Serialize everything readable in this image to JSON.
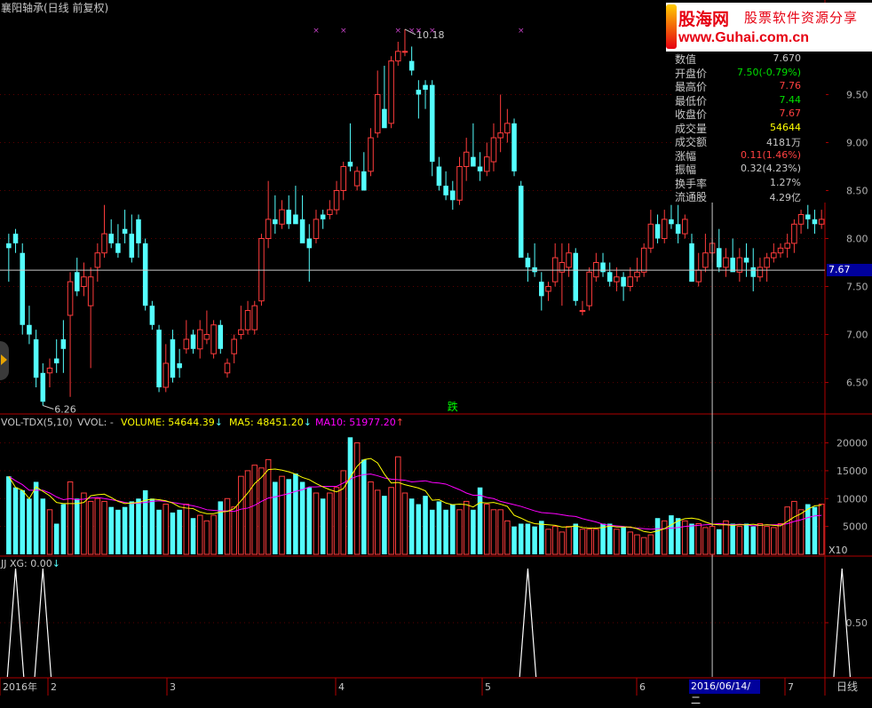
{
  "window": {
    "title": "襄阳轴承(日线 前复权)"
  },
  "ad": {
    "brand": "股海网",
    "slogan": "股票软件资源分享",
    "url": "www.Guhai.com.cn"
  },
  "main_chart": {
    "high_annotation": "10.18",
    "low_annotation": "6.26",
    "signal_text": "跌",
    "current_price": "7.67",
    "y_ticks": [
      "9.50",
      "9.00",
      "8.50",
      "8.00",
      "7.50",
      "7.00",
      "6.50"
    ],
    "info": [
      {
        "label": "数值",
        "value": "7.670",
        "color": "#c8c8c8"
      },
      {
        "label": "开盘价",
        "value": "7.50(-0.79%)",
        "color": "#00e000"
      },
      {
        "label": "最高价",
        "value": "7.76",
        "color": "#ff4040"
      },
      {
        "label": "最低价",
        "value": "7.44",
        "color": "#00e000"
      },
      {
        "label": "收盘价",
        "value": "7.67",
        "color": "#ff4040"
      },
      {
        "label": "成交量",
        "value": "54644",
        "color": "#ffff00"
      },
      {
        "label": "成交额",
        "value": "4181万",
        "color": "#c8c8c8"
      },
      {
        "label": "涨幅",
        "value": "0.11(1.46%)",
        "color": "#ff4040"
      },
      {
        "label": "振幅",
        "value": "0.32(4.23%)",
        "color": "#c8c8c8"
      },
      {
        "label": "换手率",
        "value": "1.27%",
        "color": "#c8c8c8"
      },
      {
        "label": "流通股",
        "value": "4.29亿",
        "color": "#c8c8c8"
      }
    ]
  },
  "volume_panel": {
    "name": "VOL-TDX(5,10)",
    "vvol": "VVOL: -",
    "volume": "VOLUME: 54644.39",
    "ma5": "MA5: 48451.20",
    "ma10": "MA10: 51977.20",
    "y_ticks": [
      "20000",
      "15000",
      "10000",
      "5000"
    ],
    "unit": "X10"
  },
  "jj_panel": {
    "title": "JJ XG: 0.00",
    "y_tick": "0.50"
  },
  "x_axis": {
    "labels": [
      "2016年",
      "2",
      "3",
      "4",
      "5",
      "6",
      "7"
    ],
    "cursor_date": "2016/06/14/二",
    "period": "日线"
  },
  "colors": {
    "up": "#ff3c3c",
    "down": "#54ffff",
    "ma5": "#ffff00",
    "ma10": "#ff00ff",
    "axis": "#b00000"
  },
  "chart_data": {
    "type": "candlestick",
    "title": "襄阳轴承(日线 前复权)",
    "price_ylim": [
      6.2,
      10.3
    ],
    "candles": [
      [
        7.95,
        8.05,
        7.55,
        7.9
      ],
      [
        8.05,
        8.1,
        7.85,
        7.95
      ],
      [
        7.85,
        7.95,
        7.0,
        7.1
      ],
      [
        7.1,
        7.3,
        6.9,
        7.0
      ],
      [
        6.95,
        7.05,
        6.45,
        6.55
      ],
      [
        6.6,
        6.7,
        6.26,
        6.3
      ],
      [
        6.6,
        6.75,
        6.45,
        6.65
      ],
      [
        6.75,
        6.95,
        6.6,
        6.7
      ],
      [
        6.95,
        7.15,
        6.6,
        6.85
      ],
      [
        7.2,
        7.65,
        6.35,
        7.55
      ],
      [
        7.65,
        7.8,
        7.4,
        7.45
      ],
      [
        7.5,
        7.75,
        7.4,
        7.6
      ],
      [
        7.3,
        7.7,
        6.65,
        7.6
      ],
      [
        7.7,
        7.95,
        7.55,
        7.85
      ],
      [
        7.85,
        8.35,
        7.8,
        8.05
      ],
      [
        8.05,
        8.2,
        7.9,
        7.95
      ],
      [
        7.95,
        8.15,
        7.8,
        7.85
      ],
      [
        8.1,
        8.3,
        7.95,
        8.05
      ],
      [
        8.05,
        8.25,
        7.75,
        7.8
      ],
      [
        8.2,
        8.25,
        7.8,
        7.95
      ],
      [
        7.95,
        8.0,
        7.25,
        7.3
      ],
      [
        7.3,
        7.35,
        7.05,
        7.1
      ],
      [
        7.05,
        7.1,
        6.4,
        6.45
      ],
      [
        6.45,
        6.9,
        6.4,
        6.7
      ],
      [
        6.95,
        7.05,
        6.5,
        6.55
      ],
      [
        6.7,
        6.85,
        6.55,
        6.65
      ],
      [
        6.85,
        7.15,
        6.8,
        6.95
      ],
      [
        7.0,
        7.05,
        6.8,
        6.85
      ],
      [
        6.85,
        7.15,
        6.75,
        7.05
      ],
      [
        6.95,
        7.25,
        6.9,
        7.0
      ],
      [
        6.8,
        7.15,
        6.75,
        7.1
      ],
      [
        7.1,
        7.15,
        6.8,
        6.85
      ],
      [
        6.6,
        6.75,
        6.55,
        6.7
      ],
      [
        6.8,
        7.0,
        6.7,
        6.95
      ],
      [
        7.0,
        7.3,
        6.95,
        7.05
      ],
      [
        7.05,
        7.35,
        7.0,
        7.25
      ],
      [
        7.05,
        7.35,
        7.0,
        7.3
      ],
      [
        7.35,
        8.05,
        7.3,
        8.0
      ],
      [
        8.0,
        8.6,
        7.9,
        8.2
      ],
      [
        8.2,
        8.45,
        8.05,
        8.15
      ],
      [
        8.15,
        8.4,
        8.1,
        8.3
      ],
      [
        8.3,
        8.45,
        8.1,
        8.15
      ],
      [
        8.25,
        8.55,
        8.2,
        8.15
      ],
      [
        8.2,
        8.45,
        8.05,
        7.95
      ],
      [
        8.0,
        8.15,
        7.55,
        7.9
      ],
      [
        8.0,
        8.3,
        7.95,
        8.2
      ],
      [
        8.25,
        8.3,
        8.1,
        8.2
      ],
      [
        8.25,
        8.4,
        8.2,
        8.3
      ],
      [
        8.3,
        8.6,
        8.25,
        8.5
      ],
      [
        8.5,
        8.8,
        8.4,
        8.75
      ],
      [
        8.8,
        9.2,
        8.7,
        8.75
      ],
      [
        8.55,
        8.75,
        8.5,
        8.7
      ],
      [
        8.7,
        8.9,
        8.55,
        8.5
      ],
      [
        8.7,
        9.15,
        8.65,
        9.05
      ],
      [
        9.1,
        9.75,
        9.05,
        9.5
      ],
      [
        9.35,
        9.8,
        9.2,
        9.15
      ],
      [
        9.2,
        9.9,
        9.15,
        9.85
      ],
      [
        9.85,
        10.05,
        9.8,
        9.95
      ],
      [
        9.95,
        10.18,
        9.9,
        9.95
      ],
      [
        9.85,
        10.0,
        9.7,
        9.75
      ],
      [
        9.55,
        9.65,
        9.25,
        9.5
      ],
      [
        9.6,
        9.65,
        9.35,
        9.55
      ],
      [
        9.6,
        9.65,
        8.65,
        8.8
      ],
      [
        8.75,
        8.85,
        8.5,
        8.55
      ],
      [
        8.55,
        8.7,
        8.4,
        8.45
      ],
      [
        8.5,
        8.6,
        8.3,
        8.4
      ],
      [
        8.4,
        8.85,
        8.35,
        8.75
      ],
      [
        8.75,
        9.05,
        8.6,
        8.9
      ],
      [
        8.85,
        9.2,
        8.8,
        8.75
      ],
      [
        8.75,
        8.9,
        8.6,
        8.7
      ],
      [
        8.7,
        9.0,
        8.65,
        8.85
      ],
      [
        8.8,
        9.2,
        8.7,
        9.05
      ],
      [
        9.05,
        9.5,
        8.9,
        9.1
      ],
      [
        9.1,
        9.35,
        9.0,
        9.2
      ],
      [
        9.2,
        9.25,
        8.65,
        8.7
      ],
      [
        8.55,
        8.6,
        7.85,
        7.8
      ],
      [
        7.8,
        7.85,
        7.55,
        7.7
      ],
      [
        7.7,
        7.95,
        7.6,
        7.65
      ],
      [
        7.55,
        7.65,
        7.25,
        7.4
      ],
      [
        7.45,
        7.55,
        7.35,
        7.5
      ],
      [
        7.55,
        7.95,
        7.5,
        7.8
      ],
      [
        7.65,
        7.95,
        7.3,
        7.75
      ],
      [
        7.7,
        7.95,
        7.6,
        7.85
      ],
      [
        7.85,
        7.9,
        7.3,
        7.35
      ],
      [
        7.25,
        7.35,
        7.2,
        7.25
      ],
      [
        7.3,
        7.7,
        7.25,
        7.65
      ],
      [
        7.6,
        7.85,
        7.55,
        7.75
      ],
      [
        7.75,
        7.85,
        7.6,
        7.65
      ],
      [
        7.65,
        7.75,
        7.5,
        7.55
      ],
      [
        7.55,
        7.7,
        7.45,
        7.6
      ],
      [
        7.6,
        7.65,
        7.35,
        7.5
      ],
      [
        7.5,
        7.7,
        7.45,
        7.6
      ],
      [
        7.6,
        7.8,
        7.55,
        7.65
      ],
      [
        7.65,
        7.95,
        7.6,
        7.9
      ],
      [
        7.9,
        8.3,
        7.85,
        8.15
      ],
      [
        8.15,
        8.25,
        7.95,
        8.0
      ],
      [
        8.0,
        8.3,
        7.95,
        8.2
      ],
      [
        8.2,
        8.35,
        8.1,
        8.15
      ],
      [
        8.15,
        8.35,
        7.95,
        8.05
      ],
      [
        8.05,
        8.25,
        8.0,
        8.2
      ],
      [
        7.95,
        8.05,
        7.55,
        7.55
      ],
      [
        7.55,
        7.85,
        7.5,
        7.67
      ],
      [
        7.7,
        8.05,
        7.65,
        7.85
      ],
      [
        7.85,
        8.0,
        7.75,
        7.95
      ],
      [
        7.9,
        8.1,
        7.65,
        7.7
      ],
      [
        7.7,
        7.9,
        7.6,
        7.8
      ],
      [
        7.8,
        8.0,
        7.7,
        7.65
      ],
      [
        7.65,
        7.9,
        7.55,
        7.8
      ],
      [
        7.8,
        7.95,
        7.6,
        7.75
      ],
      [
        7.7,
        7.9,
        7.45,
        7.6
      ],
      [
        7.6,
        7.8,
        7.55,
        7.7
      ],
      [
        7.7,
        7.85,
        7.55,
        7.8
      ],
      [
        7.8,
        7.95,
        7.75,
        7.85
      ],
      [
        7.85,
        7.95,
        7.8,
        7.9
      ],
      [
        7.9,
        8.05,
        7.8,
        7.95
      ],
      [
        7.95,
        8.2,
        7.85,
        8.15
      ],
      [
        8.15,
        8.3,
        8.05,
        8.25
      ],
      [
        8.25,
        8.35,
        8.1,
        8.2
      ],
      [
        8.2,
        8.3,
        8.05,
        8.15
      ],
      [
        8.15,
        8.3,
        8.1,
        8.2
      ]
    ],
    "volume_ylim": [
      0,
      22000
    ],
    "volumes": [
      14000,
      12000,
      11500,
      10000,
      13000,
      10000,
      8000,
      5500,
      9000,
      13000,
      10000,
      11000,
      9500,
      10000,
      9500,
      8500,
      8000,
      8500,
      9500,
      10000,
      11500,
      10000,
      8000,
      9000,
      7500,
      8000,
      9000,
      6500,
      7000,
      6000,
      7000,
      9500,
      10000,
      8500,
      14000,
      15000,
      16000,
      15500,
      17000,
      13000,
      14000,
      13500,
      14500,
      13000,
      12000,
      11000,
      10000,
      11000,
      12000,
      15000,
      21000,
      20000,
      17000,
      13000,
      11500,
      10500,
      12000,
      17500,
      11000,
      10000,
      9000,
      10500,
      8000,
      9500,
      8000,
      9000,
      8000,
      9500,
      8000,
      12000,
      9000,
      8000,
      8000,
      6000,
      5000,
      5500,
      5500,
      5000,
      6000,
      4500,
      5000,
      4000,
      5000,
      5500,
      4500,
      4500,
      4500,
      5500,
      5500,
      4500,
      5000,
      4000,
      3500,
      3000,
      3500,
      6500,
      6000,
      7000,
      6500,
      6000,
      5500,
      5500,
      4800,
      5000,
      4500,
      6000,
      5500,
      5000,
      5500,
      5000,
      5500,
      5000,
      4800,
      5500,
      8500,
      9500,
      8000,
      9000,
      8500,
      9000
    ],
    "ma5": [
      14000,
      12000,
      11500,
      10000,
      12100,
      11300,
      10500,
      9300,
      9100,
      9100,
      9100,
      9300,
      10500,
      10700,
      10800,
      10200,
      9500,
      9100,
      9200,
      9300,
      9700,
      9900,
      9800,
      9600,
      9200,
      8500,
      8300,
      8200,
      7600,
      7300,
      7300,
      7600,
      7700,
      8200,
      9600,
      11000,
      12700,
      13800,
      15200,
      15300,
      15100,
      14800,
      14400,
      13800,
      13400,
      12700,
      12100,
      11600,
      11200,
      11800,
      13800,
      15800,
      17000,
      17200,
      16400,
      14400,
      12800,
      12900,
      12500,
      12200,
      11900,
      11400,
      9700,
      9800,
      9200,
      8900,
      9000,
      8900,
      8500,
      9300,
      9200,
      9300,
      9000,
      8600,
      7000,
      6500,
      5900,
      5500,
      5400,
      5300,
      5200,
      4900,
      4900,
      5100,
      4800,
      4700,
      4700,
      4800,
      5100,
      4900,
      4900,
      4900,
      4600,
      4100,
      3900,
      4200,
      4600,
      5300,
      6000,
      6400,
      6500,
      6300,
      5800,
      5400,
      5300,
      5300,
      5200,
      5300,
      5300,
      5400,
      5200,
      5300,
      5200,
      5100,
      5900,
      6700,
      7300,
      8100,
      8700,
      8800
    ],
    "ma10": [
      14000,
      13200,
      12500,
      11500,
      11500,
      11500,
      11000,
      10300,
      9800,
      10000,
      9800,
      9900,
      10100,
      10200,
      10000,
      9800,
      9600,
      9300,
      9100,
      9200,
      9300,
      9500,
      9600,
      9500,
      9300,
      9100,
      8900,
      8700,
      8400,
      8000,
      7900,
      7800,
      7800,
      7700,
      8100,
      8300,
      8800,
      9500,
      10100,
      10300,
      10600,
      10900,
      11300,
      11600,
      12100,
      12100,
      12200,
      12200,
      12200,
      12800,
      13500,
      14000,
      14300,
      14400,
      14100,
      13700,
      13500,
      13400,
      13300,
      13000,
      13100,
      13200,
      12900,
      12800,
      12600,
      12100,
      11600,
      11000,
      10600,
      10600,
      10200,
      10000,
      9500,
      9200,
      8900,
      8600,
      8200,
      7800,
      7500,
      7400,
      7300,
      7100,
      6900,
      6800,
      6400,
      6100,
      5800,
      5400,
      5200,
      5100,
      5000,
      4800,
      4700,
      4600,
      4500,
      4600,
      4600,
      4700,
      4800,
      5000,
      5100,
      5200,
      5300,
      5400,
      5500,
      5400,
      5300,
      5400,
      5300,
      5100,
      5200,
      5300,
      5300,
      5300,
      5500,
      5900,
      6200,
      6600,
      6900,
      7000
    ]
  }
}
